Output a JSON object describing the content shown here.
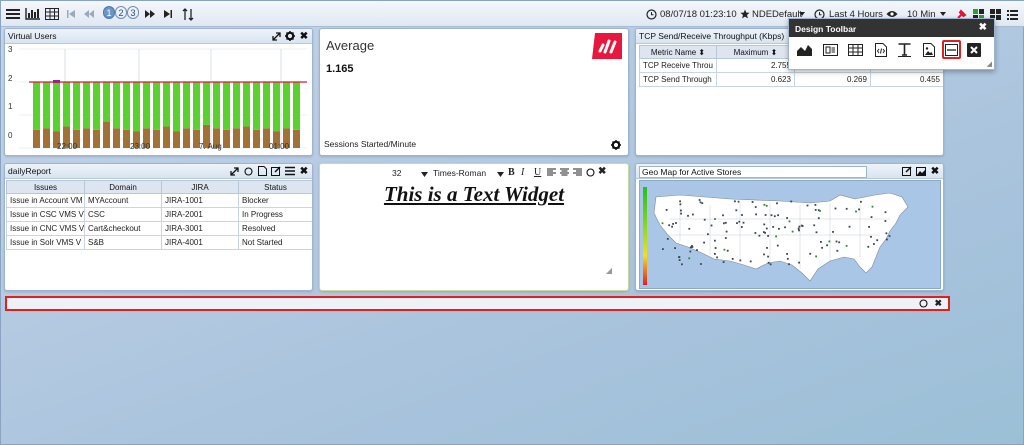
{
  "toolbar": {
    "pages": [
      "1",
      "2",
      "3"
    ],
    "active_page": "1",
    "datetime": "08/07/18 01:23:10",
    "favorite": "NDEDefault",
    "time_range": "Last 4 Hours",
    "refresh": "10 Min"
  },
  "virtual_users": {
    "title": "Virtual Users",
    "y_ticks": [
      "3",
      "2",
      "1",
      "0"
    ],
    "x_ticks": [
      "22:00",
      "23:00",
      "7. Aug",
      "01:00"
    ]
  },
  "average": {
    "title": "Average",
    "value": "1.165",
    "footer": "Sessions Started/Minute"
  },
  "tcp": {
    "title": "TCP Send/Receive Throughput (Kbps)",
    "columns": [
      "Metric Name",
      "Maximum",
      "",
      ""
    ],
    "rows": [
      {
        "name": "TCP Receive Throu",
        "max": "2.755",
        "c2": "",
        "c3": ""
      },
      {
        "name": "TCP Send Through",
        "max": "0.623",
        "c2": "0.269",
        "c3": "0.455"
      }
    ]
  },
  "daily": {
    "title": "dailyReport",
    "columns": [
      "Issues",
      "Domain",
      "JIRA",
      "Status"
    ],
    "rows": [
      {
        "issue": "Issue in Account VM",
        "domain": "MYAccount",
        "jira": "JIRA-1001",
        "status": "Blocker"
      },
      {
        "issue": "Issue in CSC VMS V",
        "domain": "CSC",
        "jira": "JIRA-2001",
        "status": "In Progress"
      },
      {
        "issue": "Issue in CNC VMS V",
        "domain": "Cart&checkout",
        "jira": "JIRA-3001",
        "status": "Resolved"
      },
      {
        "issue": "Issue in Solr VMS V",
        "domain": "S&B",
        "jira": "JIRA-4001",
        "status": "Not Started"
      }
    ]
  },
  "text_widget": {
    "font_size": "32",
    "font_family": "Times-Roman",
    "text": "This is a Text Widget"
  },
  "geo": {
    "title": "Geo Map for Active Stores"
  },
  "design_toolbar": {
    "title": "Design Toolbar"
  },
  "colors": {
    "bar_green": "#5ad12e",
    "bar_brown": "#a07238",
    "threshold_red": "#e0143c",
    "logo_red": "#e8173d",
    "highlight_red": "#e02020"
  }
}
